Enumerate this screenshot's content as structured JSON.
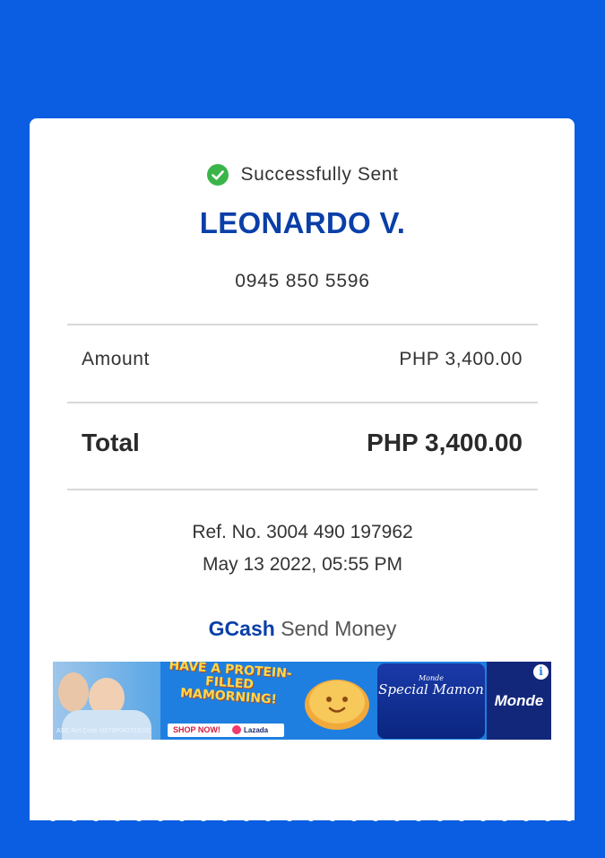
{
  "status": {
    "text": "Successfully Sent",
    "icon": "check-circle-icon",
    "color": "#3bb54a"
  },
  "recipient": {
    "name": "LEONARDO V.",
    "phone": "0945 850 5596"
  },
  "amount": {
    "label": "Amount",
    "value": "PHP 3,400.00"
  },
  "total": {
    "label": "Total",
    "value": "PHP 3,400.00"
  },
  "reference": {
    "ref_no": "Ref. No. 3004 490 197962",
    "datetime": "May 13 2022, 05:55 PM"
  },
  "brand": {
    "name": "GCash",
    "service": "Send Money"
  },
  "ad": {
    "headline": "HAVE A PROTEIN-FILLED MAMORNING!",
    "cta": "SHOP NOW!",
    "store": "Lazada",
    "product_brand": "Monde",
    "product_name": "Special Mamon",
    "ref_code": "ASC Ref Code M078P042722U/C",
    "info_icon": "info-icon"
  },
  "colors": {
    "background": "#0b5de2",
    "name": "#0a3fa8",
    "success": "#3bb54a"
  }
}
